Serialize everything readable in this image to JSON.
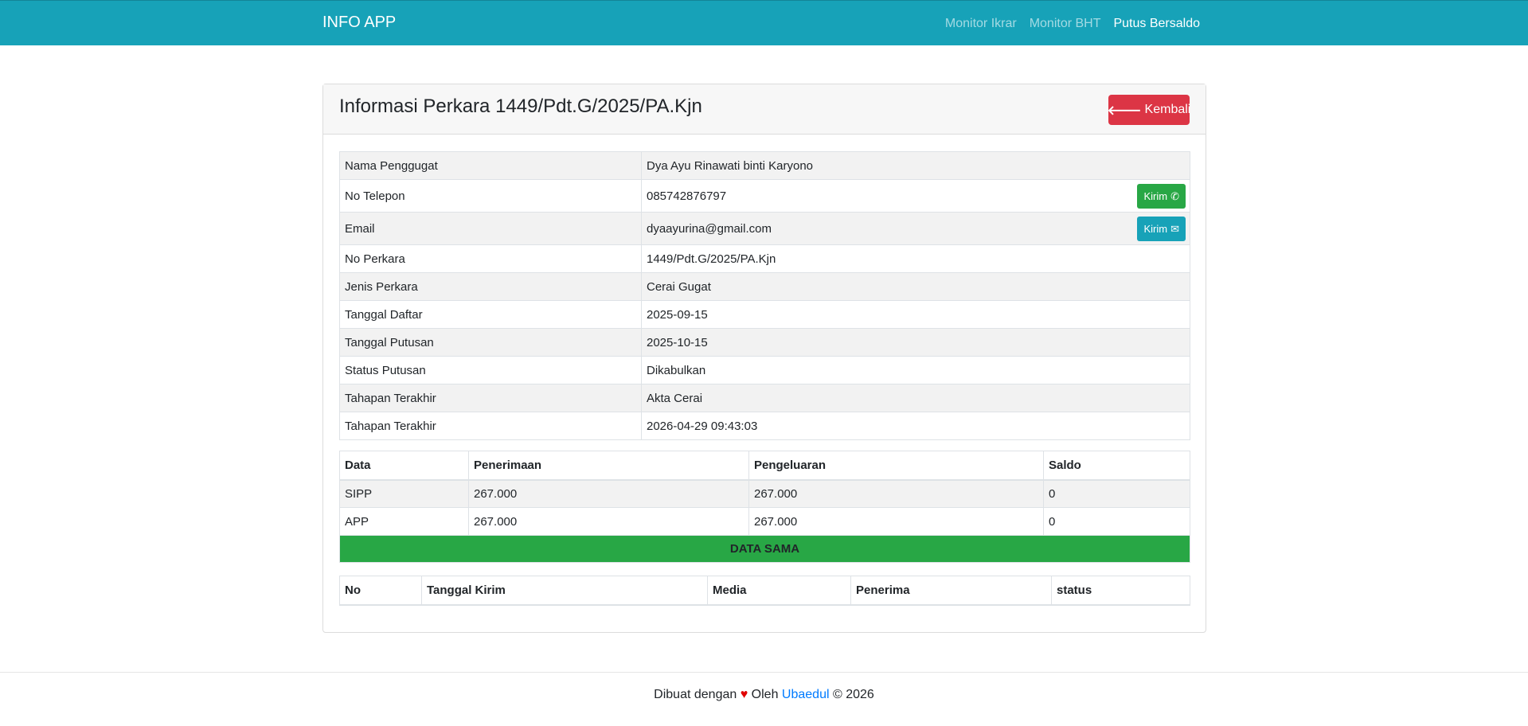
{
  "navbar": {
    "brand": "INFO APP",
    "links": [
      {
        "label": "Monitor Ikrar"
      },
      {
        "label": "Monitor BHT"
      },
      {
        "label": "Putus Bersaldo"
      }
    ]
  },
  "header": {
    "title": "Informasi Perkara 1449/Pdt.G/2025/PA.Kjn",
    "back_label": "Kembali",
    "back_icon": "arrow-left-icon"
  },
  "info": {
    "rows": [
      {
        "label": "Nama Penggugat",
        "value": "Dya Ayu Rinawati binti Karyono"
      },
      {
        "label": "No Telepon",
        "value": "085742876797",
        "action": "Kirim",
        "action_icon": "whatsapp-icon"
      },
      {
        "label": "Email",
        "value": "dyaayurina@gmail.com",
        "action": "Kirim",
        "action_icon": "envelope-icon"
      },
      {
        "label": "No Perkara",
        "value": "1449/Pdt.G/2025/PA.Kjn"
      },
      {
        "label": "Jenis Perkara",
        "value": "Cerai Gugat"
      },
      {
        "label": "Tanggal Daftar",
        "value": "2025-09-15"
      },
      {
        "label": "Tanggal Putusan",
        "value": "2025-10-15"
      },
      {
        "label": "Status Putusan",
        "value": "Dikabulkan"
      },
      {
        "label": "Tahapan Terakhir",
        "value": "Akta Cerai"
      },
      {
        "label": "Tahapan Terakhir",
        "value": "2026-04-29 09:43:03"
      }
    ]
  },
  "balance": {
    "headers": [
      "Data",
      "Penerimaan",
      "Pengeluaran",
      "Saldo"
    ],
    "rows": [
      [
        "SIPP",
        "267.000",
        "267.000",
        "0"
      ],
      [
        "APP",
        "267.000",
        "267.000",
        "0"
      ]
    ],
    "status": "DATA SAMA",
    "status_color": "#28a745"
  },
  "log": {
    "headers": [
      "No",
      "Tanggal Kirim",
      "Media",
      "Penerima",
      "status"
    ]
  },
  "footer": {
    "prefix": "Dibuat dengan",
    "heart": "♥",
    "by": "Oleh",
    "author": "Ubaedul",
    "suffix": "© 2026"
  }
}
